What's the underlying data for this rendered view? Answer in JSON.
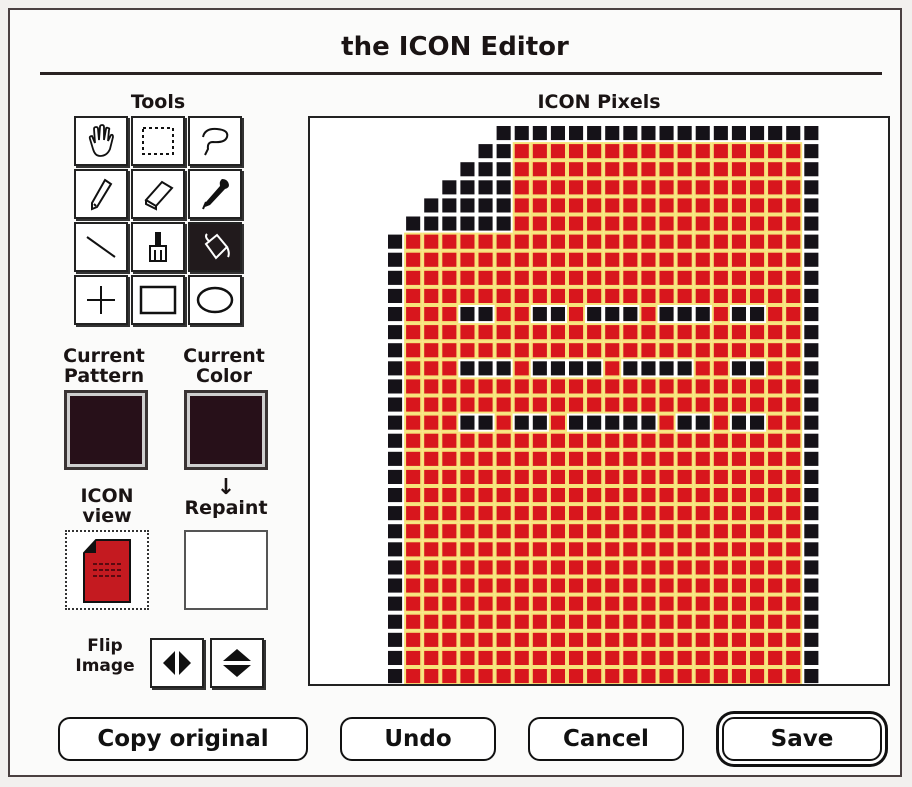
{
  "window": {
    "title": "the ICON Editor"
  },
  "tools": {
    "label": "Tools",
    "items": [
      {
        "name": "hand-tool",
        "icon": "hand-icon"
      },
      {
        "name": "marquee-tool",
        "icon": "marquee-icon"
      },
      {
        "name": "lasso-tool",
        "icon": "lasso-icon"
      },
      {
        "name": "pencil-tool",
        "icon": "pencil-icon"
      },
      {
        "name": "eraser-tool",
        "icon": "eraser-icon"
      },
      {
        "name": "eyedropper-tool",
        "icon": "eyedropper-icon"
      },
      {
        "name": "line-tool",
        "icon": "line-icon"
      },
      {
        "name": "brush-tool",
        "icon": "brush-icon"
      },
      {
        "name": "paint-bucket-tool",
        "icon": "paint-bucket-icon",
        "selected": true
      },
      {
        "name": "crosshair-tool",
        "icon": "crosshair-icon"
      },
      {
        "name": "rectangle-tool",
        "icon": "rectangle-icon"
      },
      {
        "name": "oval-tool",
        "icon": "oval-icon"
      }
    ]
  },
  "current_pattern": {
    "label_line1": "Current",
    "label_line2": "Pattern",
    "color": "#271019"
  },
  "current_color": {
    "label_line1": "Current",
    "label_line2": "Color",
    "color": "#271019"
  },
  "icon_view": {
    "label_line1": "ICON",
    "label_line2": "view"
  },
  "repaint": {
    "arrow": "↓",
    "label": "Repaint"
  },
  "flip": {
    "label_line1": "Flip",
    "label_line2": "Image"
  },
  "pixels": {
    "label": "ICON Pixels",
    "cols": 24,
    "rows": 32,
    "fill_color": "#d8161d",
    "outline_color": "#151218",
    "grid_color": "#f7e37a",
    "dark_marks": [
      {
        "row": 10,
        "cols": [
          4,
          5,
          8,
          9,
          11,
          12,
          13,
          15,
          16,
          17,
          19,
          20
        ]
      },
      {
        "row": 13,
        "cols": [
          4,
          5,
          6,
          8,
          9,
          10,
          11,
          13,
          14,
          15,
          16,
          19,
          20
        ]
      },
      {
        "row": 16,
        "cols": [
          4,
          5,
          7,
          8,
          10,
          11,
          12,
          13,
          14,
          16,
          17,
          19,
          20
        ]
      }
    ]
  },
  "buttons": {
    "copy_original": "Copy original",
    "undo": "Undo",
    "cancel": "Cancel",
    "save": "Save"
  },
  "colors": {
    "accent": "#d8161d",
    "dark": "#151218"
  }
}
